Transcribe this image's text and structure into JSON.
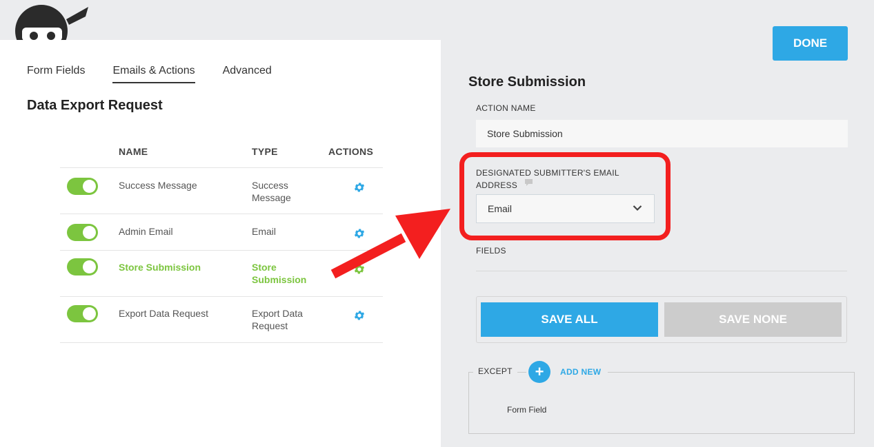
{
  "tabs": [
    {
      "label": "Form Fields",
      "active": false
    },
    {
      "label": "Emails & Actions",
      "active": true
    },
    {
      "label": "Advanced",
      "active": false
    }
  ],
  "form_title": "Data Export Request",
  "table": {
    "headers": {
      "name": "NAME",
      "type": "TYPE",
      "actions": "ACTIONS"
    },
    "rows": [
      {
        "name": "Success Message",
        "type": "Success Message",
        "enabled": true,
        "active": false
      },
      {
        "name": "Admin Email",
        "type": "Email",
        "enabled": true,
        "active": false
      },
      {
        "name": "Store Submission",
        "type": "Store Submission",
        "enabled": true,
        "active": true
      },
      {
        "name": "Export Data Request",
        "type": "Export Data Request",
        "enabled": true,
        "active": false
      }
    ]
  },
  "panel": {
    "done_label": "DONE",
    "title": "Store Submission",
    "action_name_label": "ACTION NAME",
    "action_name_value": "Store Submission",
    "email_label": "DESIGNATED SUBMITTER'S EMAIL ADDRESS",
    "email_select_value": "Email",
    "fields_label": "FIELDS",
    "save_all_label": "SAVE ALL",
    "save_none_label": "SAVE NONE",
    "except_label": "EXCEPT",
    "add_new_label": "ADD NEW",
    "form_field_label": "Form Field"
  },
  "colors": {
    "accent_blue": "#2ea8e5",
    "toggle_green": "#7cc53f",
    "highlight_red": "#f31f1f",
    "disabled_gray": "#cccccc"
  },
  "icons": [
    "ninja-logo-icon",
    "gear-icon",
    "chevron-down-icon",
    "comment-icon",
    "plus-icon",
    "arrow-annotation-icon"
  ]
}
